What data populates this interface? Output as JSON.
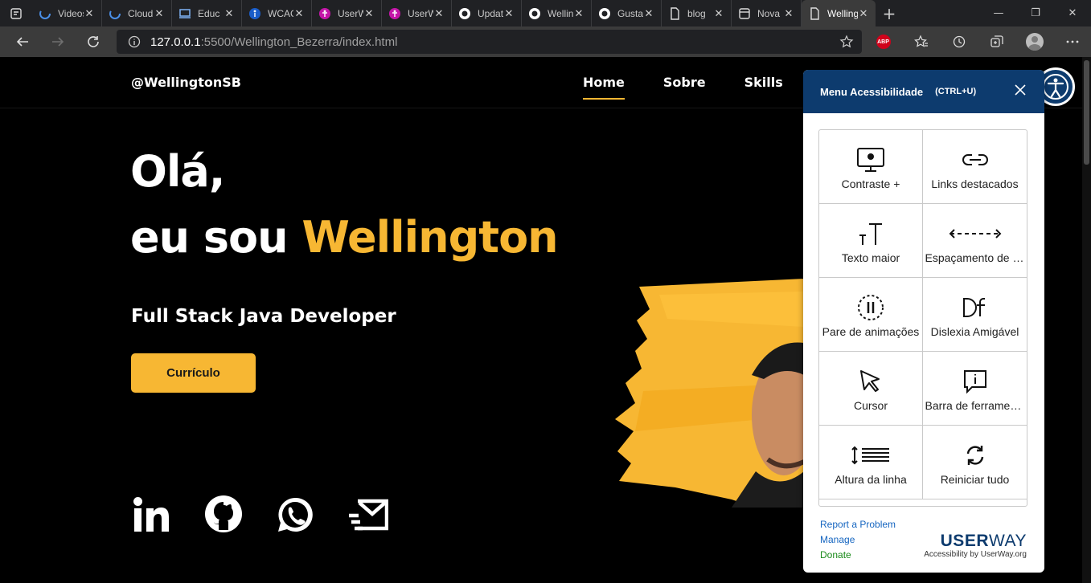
{
  "browser": {
    "tabs": [
      {
        "title": "Videos",
        "icon": "loading-icon"
      },
      {
        "title": "Cloud",
        "icon": "loading-icon"
      },
      {
        "title": "Educ",
        "icon": "laptop-icon"
      },
      {
        "title": "WCAG",
        "icon": "accessibility-icon"
      },
      {
        "title": "UserWay",
        "icon": "userway-icon"
      },
      {
        "title": "UserWay",
        "icon": "userway-icon"
      },
      {
        "title": "Update",
        "icon": "github-icon"
      },
      {
        "title": "Wellington",
        "icon": "github-icon"
      },
      {
        "title": "Gustavo",
        "icon": "github-icon"
      },
      {
        "title": "blog",
        "icon": "document-icon"
      },
      {
        "title": "Nova",
        "icon": "window-icon"
      },
      {
        "title": "Wellington",
        "icon": "page-icon"
      }
    ],
    "url_host": "127.0.0.1",
    "url_rest": ":5500/Wellington_Bezerra/index.html",
    "abp_label": "ABP"
  },
  "site": {
    "logo": "@WellingtonSB",
    "nav": [
      "Home",
      "Sobre",
      "Skills"
    ],
    "hello": "Olá,",
    "intro": "eu sou ",
    "name": "Wellington",
    "role": "Full Stack Java Developer",
    "cv_button": "Currículo"
  },
  "userway": {
    "title": "Menu Acessibilidade",
    "shortcut": "(CTRL+U)",
    "items": [
      {
        "label": "Contraste +",
        "icon": "monitor-icon"
      },
      {
        "label": "Links destacados",
        "icon": "link-icon"
      },
      {
        "label": "Texto maior",
        "icon": "text-size-icon"
      },
      {
        "label": "Espaçamento de texto",
        "icon": "spacing-icon"
      },
      {
        "label": "Pare de animações",
        "icon": "pause-icon"
      },
      {
        "label": "Dislexia Amigável",
        "icon": "dyslexia-icon"
      },
      {
        "label": "Cursor",
        "icon": "cursor-icon"
      },
      {
        "label": "Barra de ferramentas",
        "icon": "tooltip-icon"
      },
      {
        "label": "Altura da linha",
        "icon": "line-height-icon"
      },
      {
        "label": "Reiniciar tudo",
        "icon": "refresh-icon"
      }
    ],
    "links": [
      "Report a Problem",
      "Manage",
      "Donate"
    ],
    "brand_bold": "USER",
    "brand_light": "WAY",
    "brand_sub": "Accessibility by UserWay.org"
  },
  "colors": {
    "accent": "#f7b733",
    "userway_blue": "#0d3b6e",
    "background": "#000000"
  }
}
